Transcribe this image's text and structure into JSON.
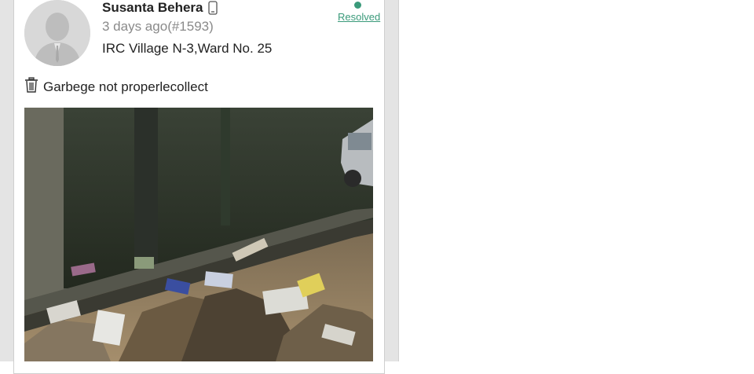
{
  "complaint": {
    "author_name": "Susanta Behera",
    "author_device_icon": "mobile-phone-icon",
    "time_ago": "3 days ago",
    "complaint_id": "(#1593)",
    "location": "IRC Village N-3,Ward No. 25",
    "status_label": "Resolved",
    "status_color": "#3a9a7a",
    "category_icon": "trash-bin-icon",
    "description": "Garbege not properlecollect",
    "photo_subject": "garbage-dump-photo"
  }
}
